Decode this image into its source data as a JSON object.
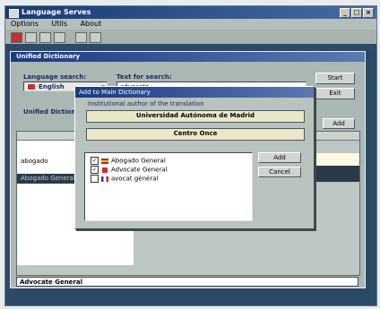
{
  "window": {
    "title": "Language Serves"
  },
  "menu": [
    "Options",
    "Utils",
    "About"
  ],
  "child": {
    "title": "Unified Dictionary",
    "language_label": "Language search:",
    "language_value": "English",
    "text_label": "Text for search:",
    "text_value": "advocate",
    "start_button": "Start",
    "exit_button": "Exit",
    "unified_label": "Unified Dictionary",
    "add_button": "Add",
    "list_items": [
      "abogado",
      "Abogado General"
    ],
    "status_text": "Advocate General"
  },
  "dialog": {
    "title": "Add to Main Dictionary",
    "group_label": "Institutional author of the translation",
    "institution_1": "Universidad Autónoma de Madrid",
    "institution_2": "Centro Once",
    "add_button": "Add",
    "cancel_button": "Cancel",
    "items": [
      {
        "label": "Abogado General",
        "checked": true,
        "flag": "spain-flag-icon"
      },
      {
        "label": "Advocate General",
        "checked": true,
        "flag": "uk-flag-icon"
      },
      {
        "label": "avocat général",
        "checked": false,
        "flag": "france-flag-icon"
      }
    ]
  },
  "colors": {
    "titlebar": "#1a3a82",
    "window_bg": "#2a4a68",
    "dialog_bg": "#b8c2be"
  }
}
